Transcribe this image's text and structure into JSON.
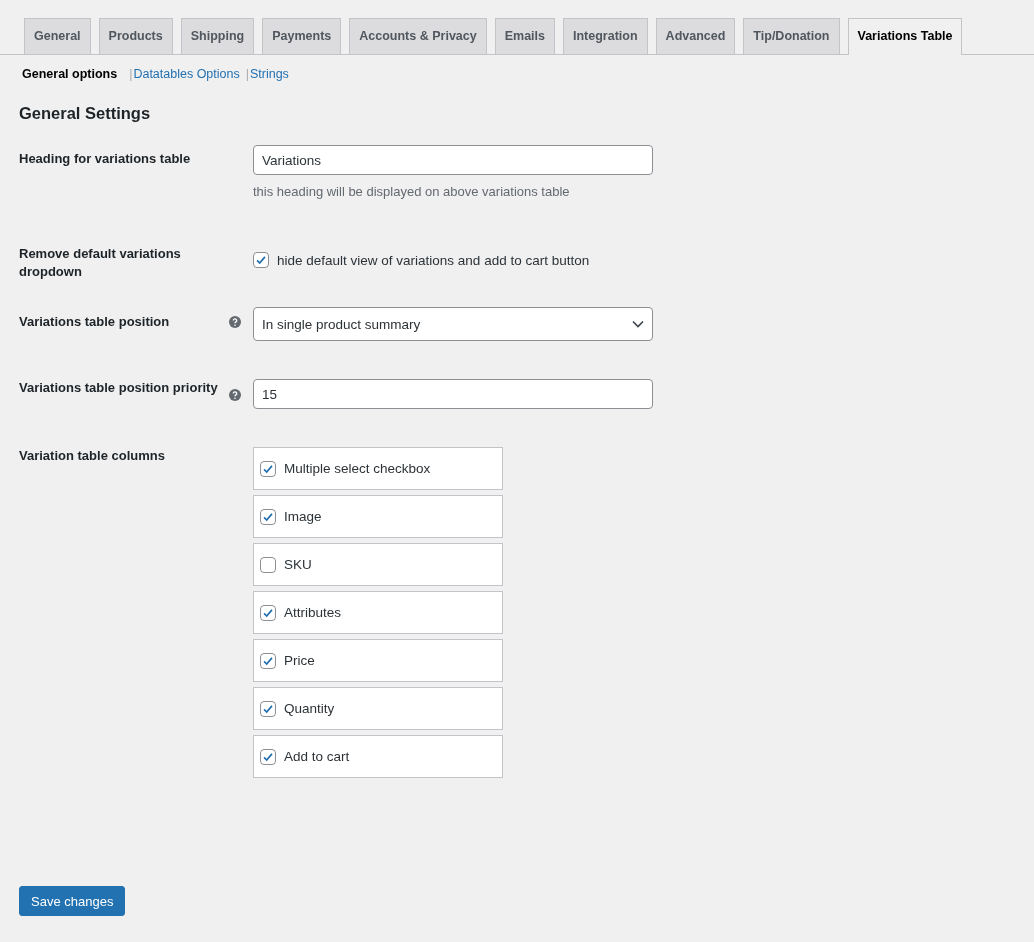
{
  "tabs": [
    {
      "label": "General",
      "selected": false
    },
    {
      "label": "Products",
      "selected": false
    },
    {
      "label": "Shipping",
      "selected": false
    },
    {
      "label": "Payments",
      "selected": false
    },
    {
      "label": "Accounts & Privacy",
      "selected": false
    },
    {
      "label": "Emails",
      "selected": false
    },
    {
      "label": "Integration",
      "selected": false
    },
    {
      "label": "Advanced",
      "selected": false
    },
    {
      "label": "Tip/Donation",
      "selected": false
    },
    {
      "label": "Variations Table",
      "selected": true
    }
  ],
  "subtabs": [
    {
      "label": "General options",
      "selected": true
    },
    {
      "separator": "|",
      "label": "Datatables Options",
      "selected": false
    },
    {
      "separator": "|",
      "label": "Strings",
      "selected": false
    }
  ],
  "section_title": "General Settings",
  "fields": [
    {
      "kind": "text",
      "label": "Heading for variations table",
      "help": false,
      "value": "Variations",
      "description": "this heading will be displayed on above variations table"
    },
    {
      "kind": "checkbox",
      "label": "Remove default variations dropdown",
      "help": false,
      "checked": true,
      "option": "hide default view of variations and add to cart button"
    },
    {
      "kind": "select",
      "label": "Variations table position",
      "help": true,
      "value": "In single product summary"
    },
    {
      "kind": "text",
      "label": "Variations table position priority",
      "help": true,
      "value": "15"
    },
    {
      "kind": "checklist",
      "label": "Variation table columns",
      "help": false,
      "options": [
        {
          "label": "Multiple select checkbox",
          "checked": true
        },
        {
          "label": "Image",
          "checked": true
        },
        {
          "label": "SKU",
          "checked": false
        },
        {
          "label": "Attributes",
          "checked": true
        },
        {
          "label": "Price",
          "checked": true
        },
        {
          "label": "Quantity",
          "checked": true
        },
        {
          "label": "Add to cart",
          "checked": true
        }
      ]
    }
  ],
  "save_button": "Save changes"
}
